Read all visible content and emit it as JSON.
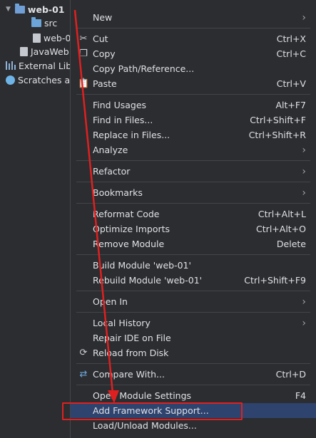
{
  "tree": {
    "root": "web-01",
    "src": "src",
    "child_file": "web-0",
    "javaweb": "JavaWeb",
    "external": "External Libr",
    "scratches": "Scratches ar"
  },
  "menu": {
    "new": "New",
    "cut": "Cut",
    "cut_sc": "Ctrl+X",
    "copy": "Copy",
    "copy_sc": "Ctrl+C",
    "copy_path": "Copy Path/Reference...",
    "paste": "Paste",
    "paste_sc": "Ctrl+V",
    "find_usages": "Find Usages",
    "find_usages_sc": "Alt+F7",
    "find_in_files": "Find in Files...",
    "find_in_files_sc": "Ctrl+Shift+F",
    "replace_in_files": "Replace in Files...",
    "replace_in_files_sc": "Ctrl+Shift+R",
    "analyze": "Analyze",
    "refactor": "Refactor",
    "bookmarks": "Bookmarks",
    "reformat": "Reformat Code",
    "reformat_sc": "Ctrl+Alt+L",
    "optimize": "Optimize Imports",
    "optimize_sc": "Ctrl+Alt+O",
    "remove_module": "Remove Module",
    "remove_module_sc": "Delete",
    "build_module": "Build Module 'web-01'",
    "rebuild_module": "Rebuild Module 'web-01'",
    "rebuild_module_sc": "Ctrl+Shift+F9",
    "open_in": "Open In",
    "local_history": "Local History",
    "repair_ide": "Repair IDE on File",
    "reload_disk": "Reload from Disk",
    "compare_with": "Compare With...",
    "compare_with_sc": "Ctrl+D",
    "module_settings": "Open Module Settings",
    "module_settings_sc": "F4",
    "add_framework": "Add Framework Support...",
    "load_unload": "Load/Unload Modules..."
  },
  "colors": {
    "background": "#2b2d30",
    "highlight": "#2e436e",
    "annotation": "#e02020"
  }
}
